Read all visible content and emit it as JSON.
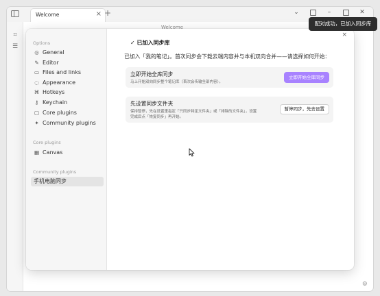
{
  "window": {
    "tab_title": "Welcome",
    "tab_close": "×",
    "new_tab": "+",
    "controls": {
      "dropdown": "⌄",
      "minimize": "–",
      "close": "✕"
    },
    "view_title": "Welcome"
  },
  "toast": {
    "text": "配对成功，已加入同步库"
  },
  "settings": {
    "close": "×",
    "sidebar": {
      "options_header": "Options",
      "options": [
        {
          "label": "General",
          "icon": "circle-settings-icon",
          "glyph": "◎"
        },
        {
          "label": "Editor",
          "icon": "pencil-icon",
          "glyph": "✎"
        },
        {
          "label": "Files and links",
          "icon": "folder-icon",
          "glyph": "▭"
        },
        {
          "label": "Appearance",
          "icon": "palette-icon",
          "glyph": "◌"
        },
        {
          "label": "Hotkeys",
          "icon": "command-icon",
          "glyph": "⌘"
        },
        {
          "label": "Keychain",
          "icon": "key-icon",
          "glyph": "⚷"
        },
        {
          "label": "Core plugins",
          "icon": "plugin-icon",
          "glyph": "▢"
        },
        {
          "label": "Community plugins",
          "icon": "puzzle-icon",
          "glyph": "✦"
        }
      ],
      "core_header": "Core plugins",
      "core": [
        {
          "label": "Canvas",
          "icon": "canvas-icon",
          "glyph": "▦"
        }
      ],
      "community_header": "Community plugins",
      "community": [
        {
          "label": "手机电脑同步",
          "active": true
        }
      ]
    },
    "content": {
      "title": "✓ 已加入同步库",
      "description": "已加入「我的笔记」。首次同步会下载云端内容并与本机双向合并——请选择如何开始：",
      "card1": {
        "title": "立即开始全库同步",
        "desc": "马上开始双向同步整个笔记库（首次会传输全部内容）。",
        "button": "立即开始全库同步"
      },
      "card2": {
        "title": "先设置同步文件夹",
        "desc_line1": "保持暂停，先在设置里指定「只同步特定文件夹」或「排除的文件夹」，设置",
        "desc_line2": "完成后点「恢复同步」再开始。",
        "button": "暂停同步，先去设置"
      }
    }
  },
  "colors": {
    "accent": "#a882ff",
    "toast_bg": "#2d2d2d"
  }
}
